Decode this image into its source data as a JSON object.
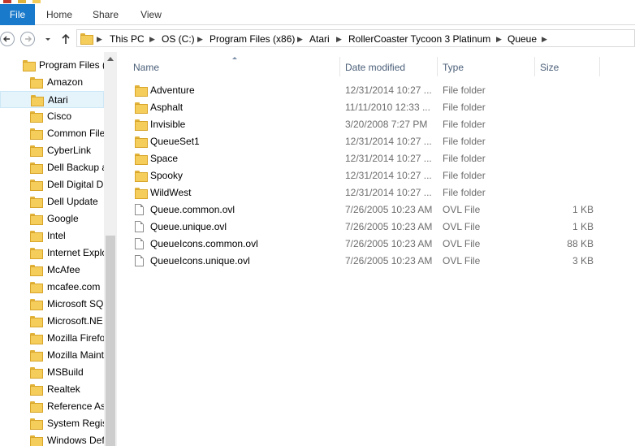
{
  "ribbon": {
    "tabs": [
      {
        "label": "File"
      },
      {
        "label": "Home"
      },
      {
        "label": "Share"
      },
      {
        "label": "View"
      }
    ]
  },
  "address": {
    "crumbs": [
      "This PC",
      "OS (C:)",
      "Program Files (x86)",
      "Atari",
      "RollerCoaster Tycoon 3 Platinum",
      "Queue"
    ]
  },
  "navpane": {
    "root": "Program Files (",
    "items": [
      {
        "label": "Amazon"
      },
      {
        "label": "Atari"
      },
      {
        "label": "Cisco"
      },
      {
        "label": "Common File"
      },
      {
        "label": "CyberLink"
      },
      {
        "label": "Dell Backup a"
      },
      {
        "label": "Dell Digital D"
      },
      {
        "label": "Dell Update"
      },
      {
        "label": "Google"
      },
      {
        "label": "Intel"
      },
      {
        "label": "Internet Explo"
      },
      {
        "label": "McAfee"
      },
      {
        "label": "mcafee.com"
      },
      {
        "label": "Microsoft SQ"
      },
      {
        "label": "Microsoft.NE"
      },
      {
        "label": "Mozilla Firefo"
      },
      {
        "label": "Mozilla Maint"
      },
      {
        "label": "MSBuild"
      },
      {
        "label": "Realtek"
      },
      {
        "label": "Reference As"
      },
      {
        "label": "System Regis"
      },
      {
        "label": "Windows Def"
      }
    ],
    "selected": "Atari"
  },
  "columns": {
    "name": "Name",
    "date": "Date modified",
    "type": "Type",
    "size": "Size"
  },
  "files": [
    {
      "name": "Adventure",
      "date": "12/31/2014 10:27 ...",
      "type": "File folder",
      "size": "",
      "kind": "folder"
    },
    {
      "name": "Asphalt",
      "date": "11/11/2010 12:33 ...",
      "type": "File folder",
      "size": "",
      "kind": "folder"
    },
    {
      "name": "Invisible",
      "date": "3/20/2008 7:27 PM",
      "type": "File folder",
      "size": "",
      "kind": "folder"
    },
    {
      "name": "QueueSet1",
      "date": "12/31/2014 10:27 ...",
      "type": "File folder",
      "size": "",
      "kind": "folder"
    },
    {
      "name": "Space",
      "date": "12/31/2014 10:27 ...",
      "type": "File folder",
      "size": "",
      "kind": "folder"
    },
    {
      "name": "Spooky",
      "date": "12/31/2014 10:27 ...",
      "type": "File folder",
      "size": "",
      "kind": "folder"
    },
    {
      "name": "WildWest",
      "date": "12/31/2014 10:27 ...",
      "type": "File folder",
      "size": "",
      "kind": "folder"
    },
    {
      "name": "Queue.common.ovl",
      "date": "7/26/2005 10:23 AM",
      "type": "OVL File",
      "size": "1 KB",
      "kind": "file"
    },
    {
      "name": "Queue.unique.ovl",
      "date": "7/26/2005 10:23 AM",
      "type": "OVL File",
      "size": "1 KB",
      "kind": "file"
    },
    {
      "name": "QueueIcons.common.ovl",
      "date": "7/26/2005 10:23 AM",
      "type": "OVL File",
      "size": "88 KB",
      "kind": "file"
    },
    {
      "name": "QueueIcons.unique.ovl",
      "date": "7/26/2005 10:23 AM",
      "type": "OVL File",
      "size": "3 KB",
      "kind": "file"
    }
  ],
  "colors": {
    "file_tab": "#1979ca",
    "selection": "#e5f3fb",
    "folder": "#f5cd5a",
    "header_text": "#4c607a",
    "meta_text": "#6d6d6d"
  }
}
